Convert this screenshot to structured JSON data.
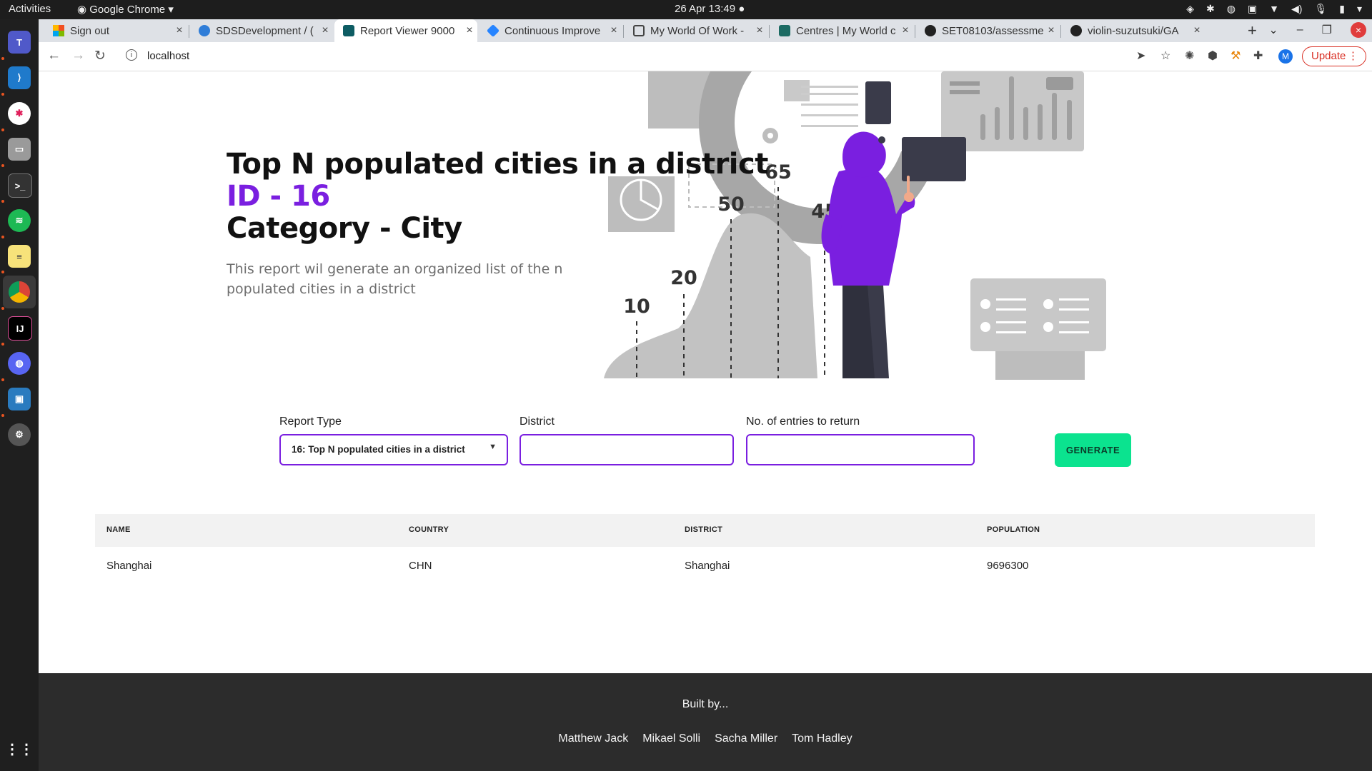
{
  "system": {
    "activities": "Activities",
    "app_name": "Google Chrome",
    "clock": "26 Apr  13:49"
  },
  "browser": {
    "tabs": [
      {
        "label": "Sign out",
        "icon": "microsoft-icon"
      },
      {
        "label": "SDSDevelopment / (",
        "icon": "azure-devops-icon"
      },
      {
        "label": "Report Viewer 9000",
        "icon": "report-viewer-icon",
        "active": true
      },
      {
        "label": "Continuous Improve",
        "icon": "jira-icon"
      },
      {
        "label": "My World Of Work -",
        "icon": "page-icon"
      },
      {
        "label": "Centres | My World c",
        "icon": "monitor-icon"
      },
      {
        "label": "SET08103/assessme",
        "icon": "github-icon"
      },
      {
        "label": "violin-suzutsuki/GA",
        "icon": "github-icon"
      }
    ],
    "url": "localhost",
    "profile_initial": "M",
    "update_label": "Update"
  },
  "hero": {
    "title_line1": "Top N populated cities in a district",
    "title_line2": "ID - 16",
    "title_line3": "Category - City",
    "description": "This report wil generate an organized list of the n populated cities in a district",
    "chart_labels": [
      "10",
      "20",
      "50",
      "65",
      "45"
    ]
  },
  "form": {
    "report_type_label": "Report Type",
    "report_type_value": "16: Top N populated cities in a district",
    "district_label": "District",
    "district_value": "",
    "entries_label": "No. of entries to return",
    "entries_value": "",
    "generate_label": "GENERATE"
  },
  "table": {
    "headers": [
      "NAME",
      "COUNTRY",
      "DISTRICT",
      "POPULATION"
    ],
    "rows": [
      [
        "Shanghai",
        "CHN",
        "Shanghai",
        "9696300"
      ]
    ]
  },
  "footer": {
    "built_by": "Built by...",
    "authors": [
      "Matthew Jack",
      "Mikael Solli",
      "Sacha Miller",
      "Tom Hadley"
    ]
  },
  "colors": {
    "accent_purple": "#7a1fe0",
    "generate_green": "#0be38f",
    "footer_bg": "#2c2c2c"
  }
}
